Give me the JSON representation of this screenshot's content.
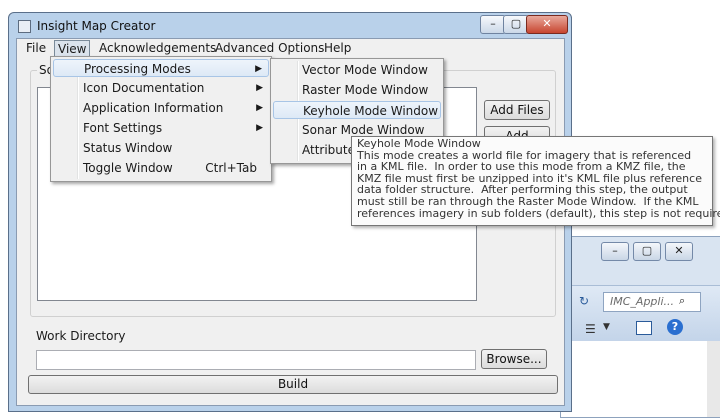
{
  "background_window": {
    "search_placeholder": "IMC_Appli...",
    "buttons": [
      "–",
      "▢",
      "✕"
    ]
  },
  "window": {
    "title": "Insight Map Creator",
    "controls": {
      "minimize": "–",
      "maximize": "▢",
      "close": "✕"
    }
  },
  "menubar": {
    "items": [
      "File",
      "View",
      "Acknowledgements",
      "Advanced Options",
      "Help"
    ]
  },
  "group": {
    "label": "So"
  },
  "buttons": {
    "add_files": "Add Files",
    "add_folders": "Add Folders",
    "browse": "Browse...",
    "build": "Build"
  },
  "work_directory": {
    "label": "Work Directory",
    "value": ""
  },
  "view_menu": {
    "items": [
      {
        "label": "Processing Modes",
        "submenu": "▶"
      },
      {
        "label": "Icon Documentation",
        "submenu": "▶"
      },
      {
        "label": "Application Information",
        "submenu": "▶"
      },
      {
        "label": "Font Settings",
        "submenu": "▶"
      },
      {
        "label": "Status Window"
      },
      {
        "label": "Toggle Window",
        "shortcut": "Ctrl+Tab"
      }
    ]
  },
  "processing_modes_menu": {
    "items": [
      "Vector Mode Window",
      "Raster Mode Window",
      "Keyhole Mode Window",
      "Sonar Mode Window",
      "Attribute M"
    ]
  },
  "tooltip": {
    "title": "Keyhole Mode Window",
    "lines": [
      "This mode creates a world file for imagery that is referenced",
      "in a KML file.  In order to use this mode from a KMZ file, the",
      "KMZ file must first be unzipped into it's KML file plus reference",
      "data folder structure.  After performing this step, the output",
      "must still be ran through the Raster Mode Window.  If the KML",
      "references imagery in sub folders (default), this step is not required."
    ]
  },
  "colors": {
    "window_frame": "#b9d1ea",
    "menu_highlight": "#dde9f6",
    "close_button": "#c7452f"
  }
}
